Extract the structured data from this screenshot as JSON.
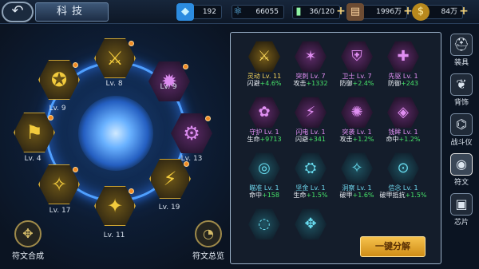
{
  "header": {
    "title": "科技",
    "resources": [
      {
        "icon": "diamond-icon",
        "value": "192",
        "plus": false
      },
      {
        "icon": "atom-icon",
        "value": "66055",
        "plus": false
      },
      {
        "icon": "battery-icon",
        "value": "36/120",
        "plus": true
      },
      {
        "icon": "stack-icon",
        "value": "1996万",
        "plus": true
      },
      {
        "icon": "coin-icon",
        "value": "84万",
        "plus": true
      }
    ]
  },
  "ring_nodes": [
    {
      "level": "Lv. 8",
      "color": "gold",
      "glyph": "⚔"
    },
    {
      "level": "Lv. 9",
      "color": "purple",
      "glyph": "✹"
    },
    {
      "level": "Lv. 13",
      "color": "purple",
      "glyph": "⚙"
    },
    {
      "level": "Lv. 19",
      "color": "gold",
      "glyph": "⚡"
    },
    {
      "level": "Lv. 11",
      "color": "gold",
      "glyph": "✦"
    },
    {
      "level": "Lv. 17",
      "color": "gold",
      "glyph": "✧"
    },
    {
      "level": "Lv. 4",
      "color": "gold",
      "glyph": "⚑"
    },
    {
      "level": "Lv. 9",
      "color": "gold",
      "glyph": "✪"
    }
  ],
  "bottom_buttons": {
    "compose": "符文合成",
    "overview": "符文总览"
  },
  "inventory": [
    {
      "name": "灵动 Lv. 11",
      "stat": "闪避",
      "bonus": "+4.6%",
      "tier": "gold",
      "glyph": "⚔"
    },
    {
      "name": "突刺 Lv. 7",
      "stat": "攻击",
      "bonus": "+1332",
      "tier": "purple",
      "glyph": "✶"
    },
    {
      "name": "卫士 Lv. 7",
      "stat": "防御",
      "bonus": "+2.4%",
      "tier": "purple",
      "glyph": "⛨"
    },
    {
      "name": "先驱 Lv. 1",
      "stat": "防御",
      "bonus": "+243",
      "tier": "purple",
      "glyph": "✚"
    },
    {
      "name": "守护 Lv. 1",
      "stat": "生命",
      "bonus": "+9713",
      "tier": "purple",
      "glyph": "✿"
    },
    {
      "name": "闪电 Lv. 1",
      "stat": "闪避",
      "bonus": "+341",
      "tier": "purple",
      "glyph": "⚡"
    },
    {
      "name": "突袭 Lv. 1",
      "stat": "攻击",
      "bonus": "+1.2%",
      "tier": "purple",
      "glyph": "✺"
    },
    {
      "name": "钱眸 Lv. 1",
      "stat": "命中",
      "bonus": "+1.2%",
      "tier": "purple",
      "glyph": "◈"
    },
    {
      "name": "瞄准 Lv. 1",
      "stat": "命中",
      "bonus": "+158",
      "tier": "teal",
      "glyph": "◎"
    },
    {
      "name": "坚金 Lv. 1",
      "stat": "生命",
      "bonus": "+1.5%",
      "tier": "teal",
      "glyph": "⛭"
    },
    {
      "name": "洞察 Lv. 1",
      "stat": "破甲",
      "bonus": "+1.6%",
      "tier": "teal",
      "glyph": "✧"
    },
    {
      "name": "信念 Lv. 1",
      "stat": "破甲抵抗",
      "bonus": "+1.5%",
      "tier": "teal",
      "glyph": "⊙"
    },
    {
      "name": "",
      "stat": "",
      "bonus": "",
      "tier": "teal",
      "glyph": "◌"
    },
    {
      "name": "",
      "stat": "",
      "bonus": "",
      "tier": "teal",
      "glyph": "✥"
    }
  ],
  "decompose_label": "一键分解",
  "sidebar": [
    {
      "label": "装具",
      "icon": "gear-armor-icon",
      "glyph": "⛑",
      "active": false
    },
    {
      "label": "背饰",
      "icon": "wing-icon",
      "glyph": "❦",
      "active": false
    },
    {
      "label": "战斗仪",
      "icon": "device-icon",
      "glyph": "⌬",
      "active": false
    },
    {
      "label": "符文",
      "icon": "rune-icon",
      "glyph": "◉",
      "active": true
    },
    {
      "label": "芯片",
      "icon": "chip-icon",
      "glyph": "▣",
      "active": false
    }
  ],
  "colors": {
    "gold": "#f2cb3d",
    "purple": "#dc8cf0",
    "teal": "#5ad6ea",
    "bonus": "#47e46a",
    "button": "#f6c24d"
  }
}
